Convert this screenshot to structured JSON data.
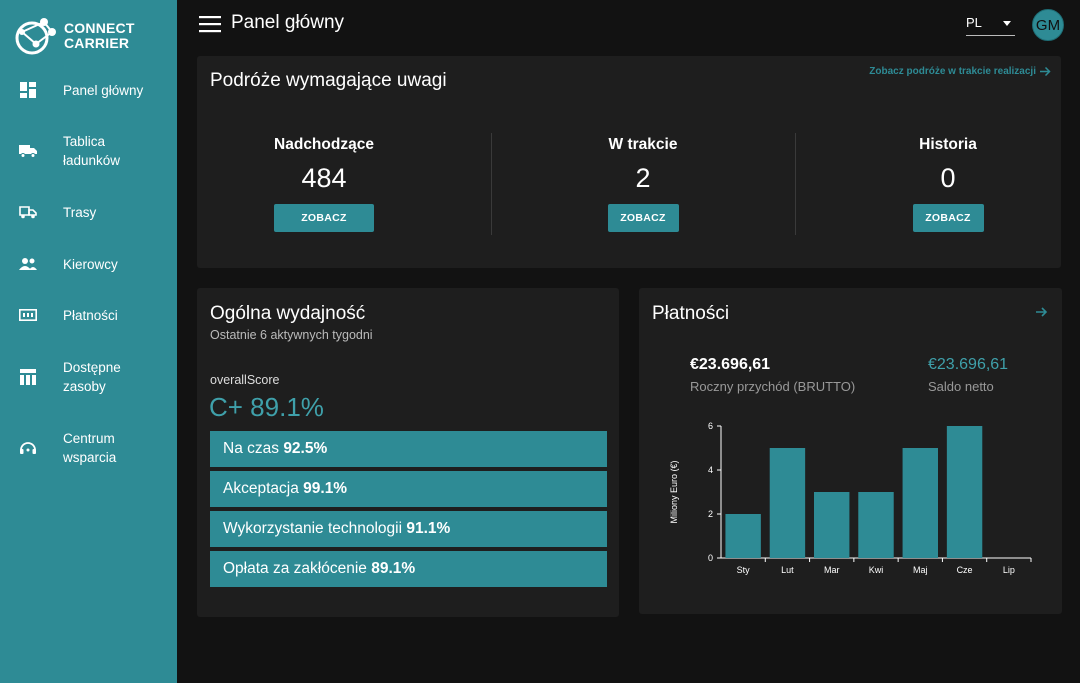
{
  "brand": {
    "line1": "CONNECT",
    "line2": "CARRIER"
  },
  "sidebar": {
    "items": [
      {
        "label": "Panel główny",
        "icon": "dashboard-icon"
      },
      {
        "label": "Tablica ładunków",
        "icon": "truck-icon"
      },
      {
        "label": "Trasy",
        "icon": "route-truck-icon"
      },
      {
        "label": "Kierowcy",
        "icon": "people-icon"
      },
      {
        "label": "Płatności",
        "icon": "payments-icon"
      },
      {
        "label": "Dostępne zasoby",
        "icon": "resources-icon"
      },
      {
        "label": "Centrum wsparcia",
        "icon": "support-icon"
      }
    ]
  },
  "header": {
    "title": "Panel główny",
    "language": "PL",
    "avatar_initials": "GM"
  },
  "trips": {
    "title": "Podróże wymagające uwagi",
    "link": "Zobacz podróże w trakcie realizacji",
    "stats": [
      {
        "label": "Nadchodzące",
        "value": "484",
        "button": "ZOBACZ"
      },
      {
        "label": "W trakcie",
        "value": "2",
        "button": "ZOBACZ"
      },
      {
        "label": "Historia",
        "value": "0",
        "button": "ZOBACZ"
      }
    ]
  },
  "performance": {
    "title": "Ogólna wydajność",
    "subtitle": "Ostatnie 6 aktywnych tygodni",
    "score_label": "overallScore",
    "score_value": "C+ 89.1%",
    "metrics": [
      {
        "label": "Na czas",
        "value": "92.5%"
      },
      {
        "label": "Akceptacja",
        "value": "99.1%"
      },
      {
        "label": "Wykorzystanie technologii",
        "value": "91.1%"
      },
      {
        "label": "Opłata za zakłócenie",
        "value": "89.1%"
      }
    ]
  },
  "payments": {
    "title": "Płatności",
    "gross_amount": "€23.696,61",
    "gross_label": "Roczny przychód (BRUTTO)",
    "net_amount": "€23.696,61",
    "net_label": "Saldo netto"
  },
  "chart_data": {
    "type": "bar",
    "categories": [
      "Sty",
      "Lut",
      "Mar",
      "Kwi",
      "Maj",
      "Cze",
      "Lip"
    ],
    "values": [
      2,
      5,
      3,
      3,
      5,
      6,
      0
    ],
    "ylabel": "Miliony Euro (€)",
    "ylim": [
      0,
      6
    ],
    "yticks": [
      "0",
      "2",
      "4",
      "6"
    ],
    "bar_color": "#2e8b95"
  },
  "colors": {
    "accent": "#2e8b95",
    "background": "#121212",
    "card": "#1e1e1e"
  }
}
